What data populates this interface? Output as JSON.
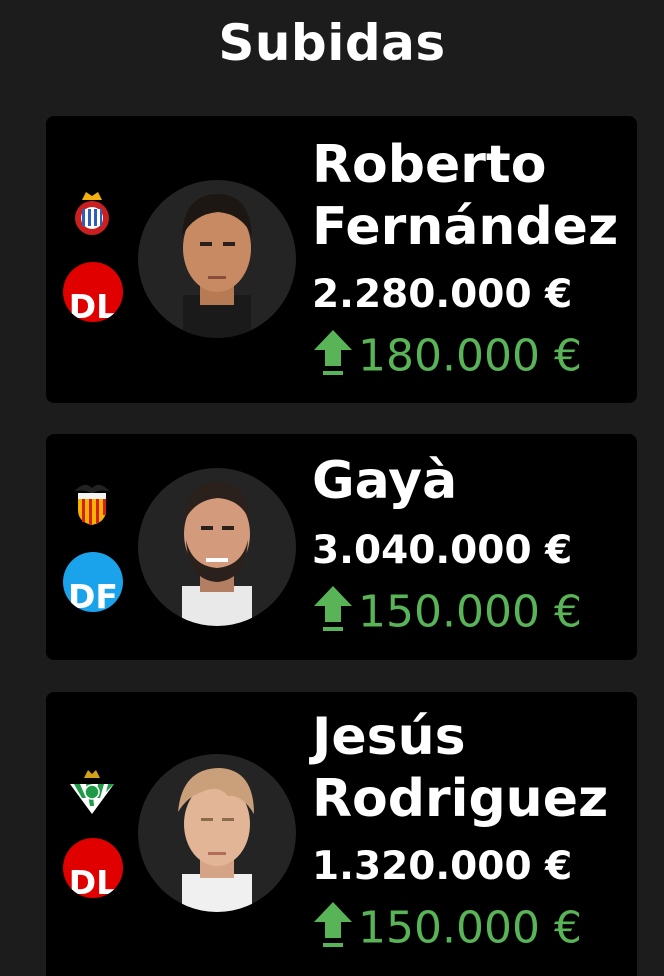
{
  "page": {
    "title": "Subidas"
  },
  "colors": {
    "background": "#1c1c1c",
    "card": "#000000",
    "rise": "#58b456",
    "dl_badge": "#e00000",
    "df_badge": "#1aa3ea"
  },
  "players": [
    {
      "name_line1": "Roberto",
      "name_line2": "Fernández",
      "club": "RCD Espanyol",
      "club_icon": "espanyol-crest-icon",
      "position": "DL",
      "price": "2.280.000 €",
      "rise": "180.000 €"
    },
    {
      "name_line1": "Gayà",
      "name_line2": "",
      "club": "Valencia CF",
      "club_icon": "valencia-crest-icon",
      "position": "DF",
      "price": "3.040.000 €",
      "rise": "150.000 €"
    },
    {
      "name_line1": "Jesús",
      "name_line2": "Rodriguez",
      "club": "Real Betis",
      "club_icon": "betis-crest-icon",
      "position": "DL",
      "price": "1.320.000 €",
      "rise": "150.000 €"
    }
  ]
}
